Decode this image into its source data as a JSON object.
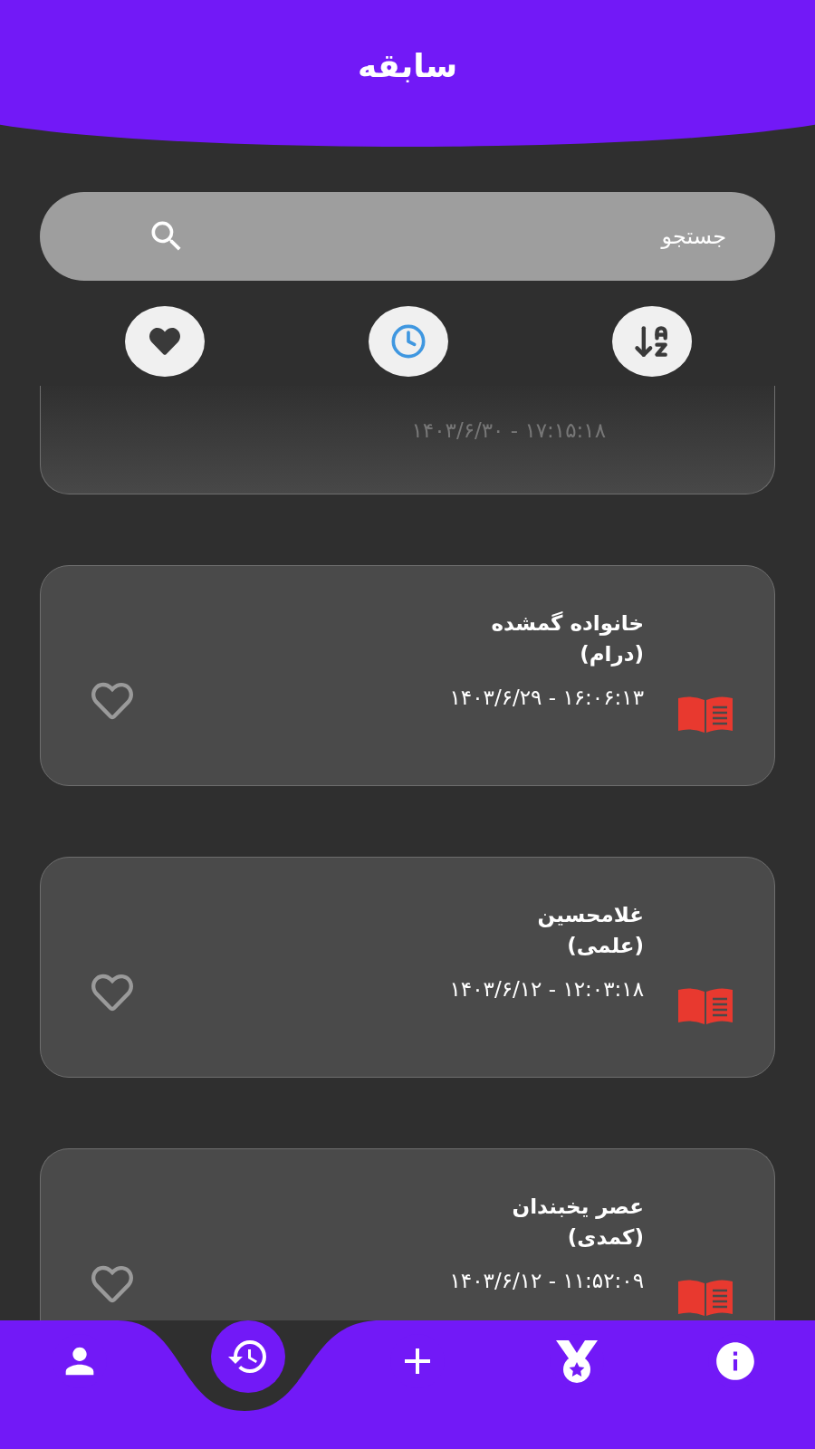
{
  "header": {
    "title": "سابقه"
  },
  "search": {
    "placeholder": "جستجو"
  },
  "filters": [
    {
      "kind": "favorites",
      "selected": false
    },
    {
      "kind": "time",
      "selected": true
    },
    {
      "kind": "alphabetical",
      "selected": false
    }
  ],
  "items": [
    {
      "datetime": "۱۷:۱۵:۱۸ - ۱۴۰۳/۶/۳۰",
      "partial": true
    },
    {
      "title": "خانواده گمشده",
      "genre": "(درام)",
      "datetime": "۱۶:۰۶:۱۳ - ۱۴۰۳/۶/۲۹",
      "partial": false,
      "favorite": false
    },
    {
      "title": "غلامحسین",
      "genre": "(علمی)",
      "datetime": "۱۲:۰۳:۱۸ - ۱۴۰۳/۶/۱۲",
      "partial": false,
      "favorite": false
    },
    {
      "title": "عصر یخبندان",
      "genre": "(کمدی)",
      "datetime": "۱۱:۵۲:۰۹ - ۱۴۰۳/۶/۱۲",
      "partial": false,
      "favorite": false
    }
  ],
  "nav": [
    {
      "kind": "profile",
      "selected": false
    },
    {
      "kind": "history",
      "selected": true
    },
    {
      "kind": "add",
      "selected": false
    },
    {
      "kind": "medal",
      "selected": false
    },
    {
      "kind": "info",
      "selected": false
    }
  ]
}
